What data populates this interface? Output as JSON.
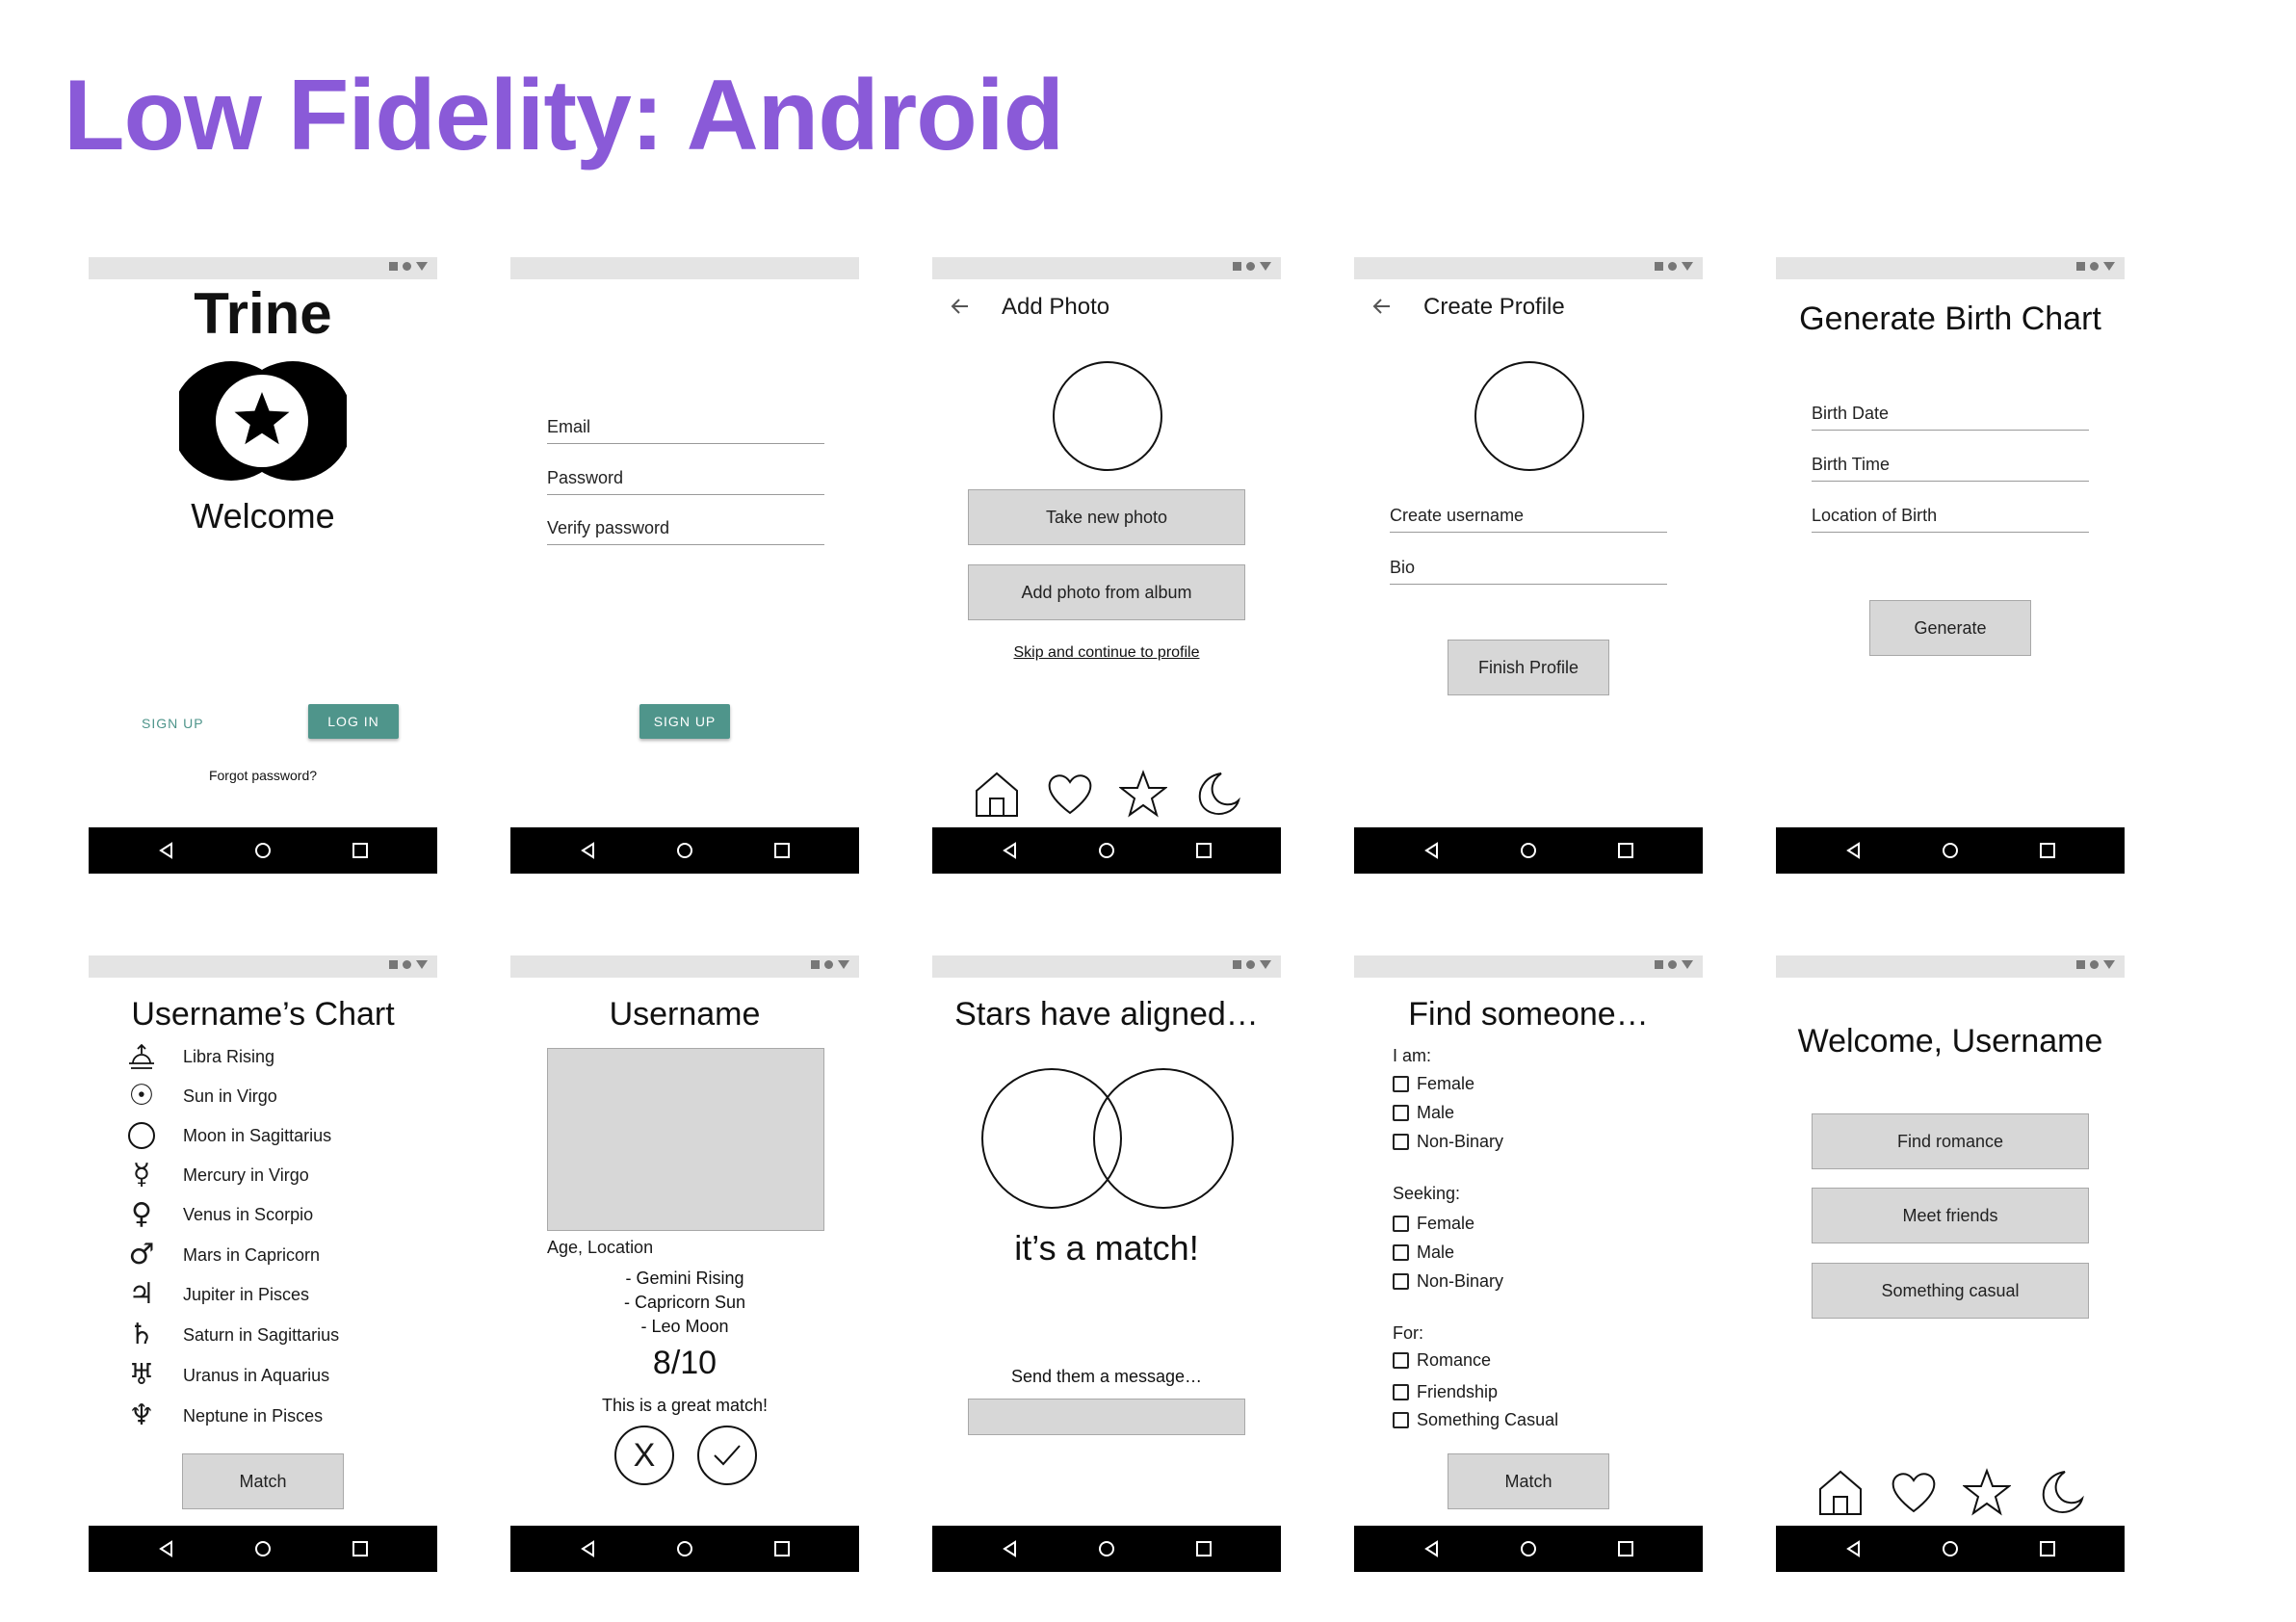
{
  "page_title": "Low Fidelity: Android",
  "s1": {
    "app_name": "Trine",
    "welcome": "Welcome",
    "signup": "SIGN UP",
    "login": "LOG IN",
    "forgot": "Forgot password?"
  },
  "s2": {
    "email": "Email",
    "password": "Password",
    "verify": "Verify password",
    "signup": "SIGN UP"
  },
  "s3": {
    "title": "Add Photo",
    "take_photo": "Take new photo",
    "add_album": "Add photo from album",
    "skip": "Skip and continue to profile"
  },
  "s4": {
    "title": "Create Profile",
    "username": "Create username",
    "bio": "Bio",
    "finish": "Finish Profile"
  },
  "s5": {
    "title": "Generate Birth Chart",
    "birth_date": "Birth Date",
    "birth_time": "Birth Time",
    "location": "Location of Birth",
    "generate": "Generate"
  },
  "s6": {
    "title": "Username’s Chart",
    "planets": [
      {
        "symbol": "rising-icon",
        "label": "Libra Rising"
      },
      {
        "symbol": "sun-icon",
        "glyph": "☉",
        "label": "Sun in Virgo"
      },
      {
        "symbol": "moon-circle-icon",
        "label": "Moon in Sagittarius"
      },
      {
        "symbol": "mercury-icon",
        "glyph": "☿",
        "label": "Mercury in Virgo"
      },
      {
        "symbol": "venus-icon",
        "glyph": "♀",
        "label": "Venus in Scorpio"
      },
      {
        "symbol": "mars-icon",
        "glyph": "♂",
        "label": "Mars in Capricorn"
      },
      {
        "symbol": "jupiter-icon",
        "glyph": "♃",
        "label": "Jupiter in Pisces"
      },
      {
        "symbol": "saturn-icon",
        "glyph": "♄",
        "label": "Saturn in Sagittarius"
      },
      {
        "symbol": "uranus-icon",
        "glyph": "♅",
        "label": "Uranus in Aquarius"
      },
      {
        "symbol": "neptune-icon",
        "glyph": "♆",
        "label": "Neptune in Pisces"
      }
    ],
    "match": "Match"
  },
  "s7": {
    "title": "Username",
    "age_location": "Age, Location",
    "gemini": "- Gemini Rising",
    "capricorn": "- Capricorn Sun",
    "leo": "- Leo Moon",
    "score": "8/10",
    "great_match": "This is a great match!",
    "reject": "X"
  },
  "s8": {
    "title": "Stars have aligned…",
    "match_text": "it’s a match!",
    "send_message": "Send them a message…"
  },
  "s9": {
    "title": "Find someone…",
    "i_am": "I am:",
    "i_am_options": [
      "Female",
      "Male",
      "Non-Binary"
    ],
    "seeking": "Seeking:",
    "seeking_options": [
      "Female",
      "Male",
      "Non-Binary"
    ],
    "for": "For:",
    "for_options": [
      "Romance",
      "Friendship",
      "Something Casual"
    ],
    "match": "Match"
  },
  "s10": {
    "title": "Welcome, Username",
    "romance": "Find romance",
    "friends": "Meet friends",
    "casual": "Something casual"
  },
  "colors": {
    "title": "#8a5ad8",
    "teal": "#4f958b",
    "button_gray": "#d7d7d7",
    "status_bar": "#e4e4e4"
  }
}
